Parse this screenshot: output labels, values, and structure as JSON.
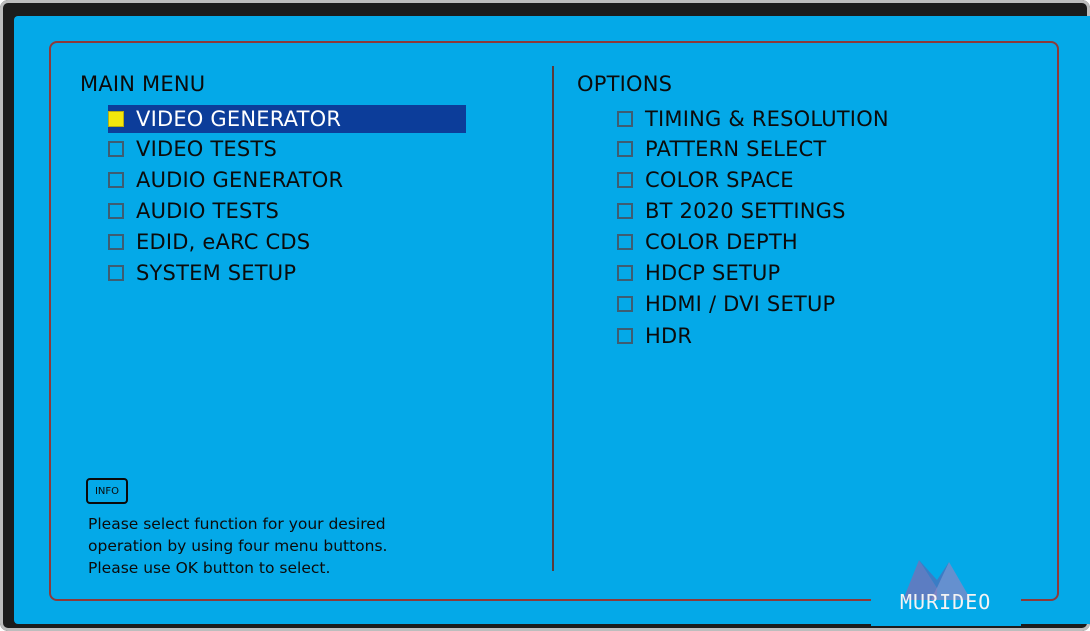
{
  "main_menu": {
    "title": "MAIN MENU",
    "items": [
      {
        "label": "VIDEO GENERATOR",
        "selected": true
      },
      {
        "label": "VIDEO TESTS",
        "selected": false
      },
      {
        "label": "AUDIO GENERATOR",
        "selected": false
      },
      {
        "label": "AUDIO TESTS",
        "selected": false
      },
      {
        "label": "EDID, eARC CDS",
        "selected": false
      },
      {
        "label": "SYSTEM SETUP",
        "selected": false
      }
    ]
  },
  "options": {
    "title": "OPTIONS",
    "items": [
      {
        "label": "TIMING & RESOLUTION"
      },
      {
        "label": "PATTERN SELECT"
      },
      {
        "label": "COLOR SPACE"
      },
      {
        "label": "BT 2020 SETTINGS"
      },
      {
        "label": "COLOR DEPTH"
      },
      {
        "label": "HDCP SETUP"
      },
      {
        "label": "HDMI / DVI SETUP"
      },
      {
        "label": "HDR"
      }
    ]
  },
  "info": {
    "button_label": "INFO",
    "help_lines": [
      "Please select function for your desired",
      "operation by using four menu buttons.",
      "Please use OK button to select."
    ]
  },
  "brand": {
    "name": "MURIDEO"
  },
  "colors": {
    "screen_background": "#04a9e8",
    "selection_highlight": "#0c3d9a",
    "selected_box": "#f3e70c",
    "frame_border": "#8d3a3a"
  },
  "icons": {
    "checkbox": "checkbox-icon",
    "logo": "murideo-logo-icon"
  }
}
